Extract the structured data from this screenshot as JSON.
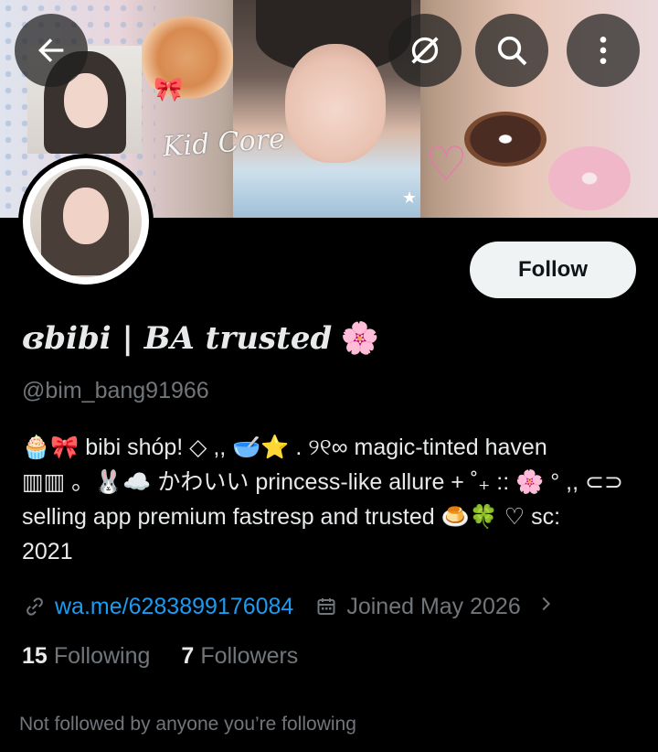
{
  "profile": {
    "name_text": "bibi | BA trusted",
    "name_prefix_glyph": "ɞ",
    "name_emoji": "🌸",
    "handle": "@bim_bang91966",
    "bio": "🧁🎀 bibi shóp! ◇ ,, 🥣⭐ . ୨୧∞ magic-tinted haven\n▥▥ 。🐰☁️ かわいい princess-like allure + ˚₊ :: 🌸 ° ,, ⊂⊃\nselling app premium fastresp and trusted 🍮🍀 ♡ sc:\n2021",
    "link": "wa.me/6283899176084",
    "joined": "Joined May 2026",
    "following_count": "15",
    "following_label": "Following",
    "followers_count": "7",
    "followers_label": "Followers",
    "not_followed_text": "Not followed by anyone you’re following"
  },
  "banner": {
    "text": "Kid Core"
  },
  "actions": {
    "follow_label": "Follow"
  },
  "icons": {
    "back": "arrow-left-icon",
    "grok": "grok-icon",
    "search": "search-icon",
    "more": "more-vertical-icon",
    "link": "link-icon",
    "calendar": "calendar-icon",
    "chevron": "chevron-right-icon"
  },
  "colors": {
    "accent": "#1d9bf0",
    "muted": "#71767b",
    "text": "#e7e9ea",
    "background": "#000000",
    "follow_bg": "#eff3f4"
  }
}
